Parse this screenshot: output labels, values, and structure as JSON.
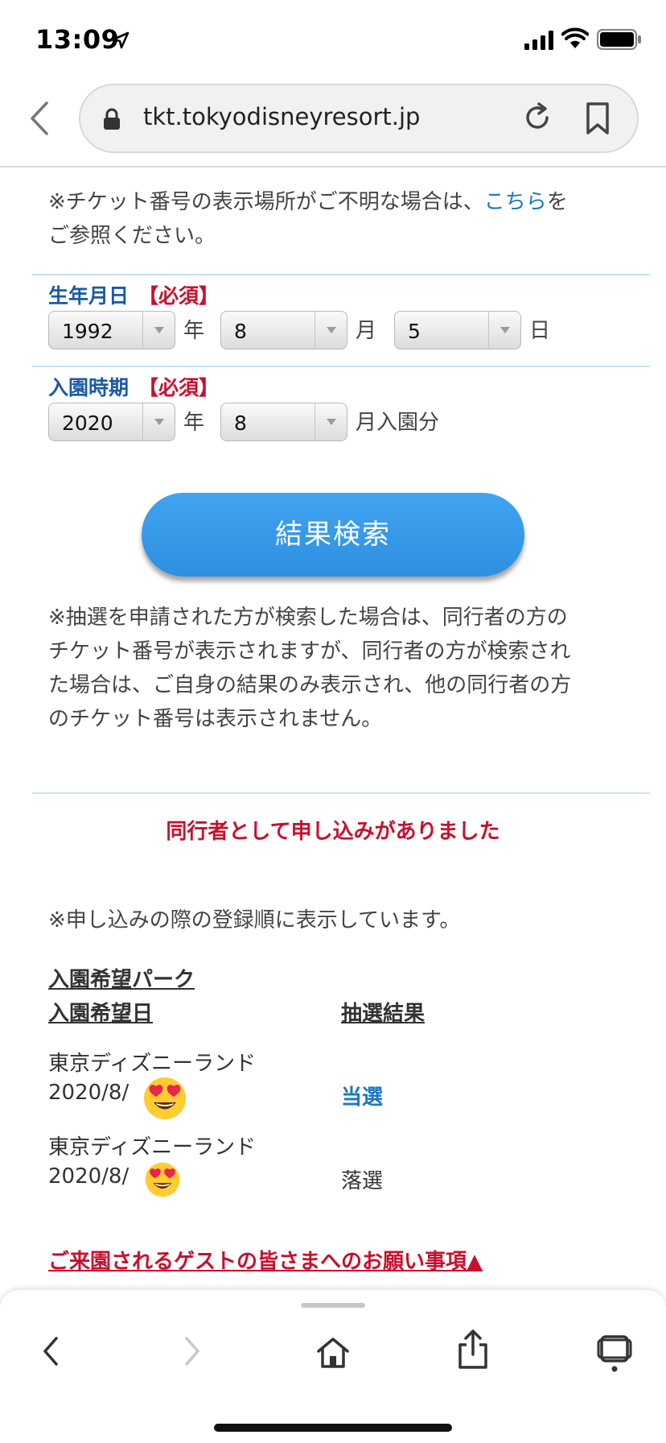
{
  "status_bar": {
    "time": "13:09"
  },
  "browser": {
    "url": "tkt.tokyodisneyresort.jp"
  },
  "notes": {
    "ticket_note_prefix": "※チケット番号の表示場所がご不明な場合は、",
    "ticket_note_link": "こちら",
    "ticket_note_suffix_1": "を",
    "ticket_note_suffix_2": "ご参照ください。"
  },
  "form": {
    "birthdate_label": "生年月日",
    "required_label": "【必須】",
    "birth_year": "1992",
    "year_unit": "年",
    "birth_month": "8",
    "month_unit": "月",
    "birth_day": "5",
    "day_unit": "日",
    "visit_label": "入園時期",
    "visit_year": "2020",
    "visit_month": "8",
    "visit_month_unit": "月入園分",
    "search_button": "結果検索"
  },
  "explanation": [
    "※抽選を申請された方が検索した場合は、同行者の方の",
    "チケット番号が表示されますが、同行者の方が検索され",
    "た場合は、ご自身の結果のみ表示され、他の同行者の方",
    "のチケット番号は表示されません。"
  ],
  "result": {
    "alert": "同行者として申し込みがありました",
    "order_note": "※申し込みの際の登録順に表示しています。",
    "header_park": "入園希望パーク",
    "header_date": "入園希望日",
    "header_result": "抽選結果",
    "rows": [
      {
        "park": "東京ディズニーランド",
        "date": "2020/8/",
        "result": "当選"
      },
      {
        "park": "東京ディズニーランド",
        "date": "2020/8/",
        "result": "落選"
      }
    ]
  },
  "footer_link": "ご来園されるゲストの皆さまへのお願い事項▲"
}
